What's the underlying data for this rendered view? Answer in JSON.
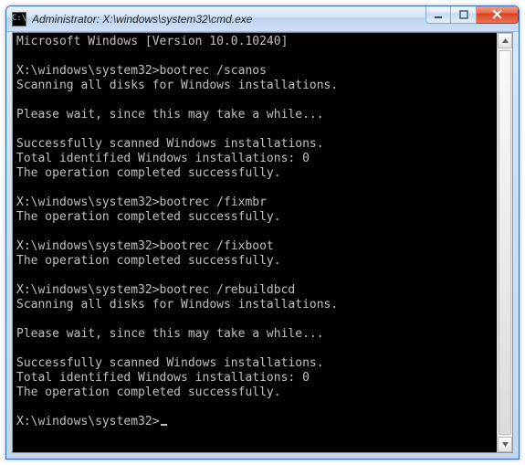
{
  "window": {
    "icon_glyph": "C:\\",
    "title": "Administrator: X:\\windows\\system32\\cmd.exe"
  },
  "terminal": {
    "prompt": "X:\\windows\\system32>",
    "lines": [
      "Microsoft Windows [Version 10.0.10240]",
      "",
      "X:\\windows\\system32>bootrec /scanos",
      "Scanning all disks for Windows installations.",
      "",
      "Please wait, since this may take a while...",
      "",
      "Successfully scanned Windows installations.",
      "Total identified Windows installations: 0",
      "The operation completed successfully.",
      "",
      "X:\\windows\\system32>bootrec /fixmbr",
      "The operation completed successfully.",
      "",
      "X:\\windows\\system32>bootrec /fixboot",
      "The operation completed successfully.",
      "",
      "X:\\windows\\system32>bootrec /rebuildbcd",
      "Scanning all disks for Windows installations.",
      "",
      "Please wait, since this may take a while...",
      "",
      "Successfully scanned Windows installations.",
      "Total identified Windows installations: 0",
      "The operation completed successfully.",
      ""
    ]
  },
  "colors": {
    "terminal_bg": "#000000",
    "terminal_fg": "#c0c0c0",
    "frame_accent": "#cfe0f5",
    "close_red": "#d9411e"
  }
}
